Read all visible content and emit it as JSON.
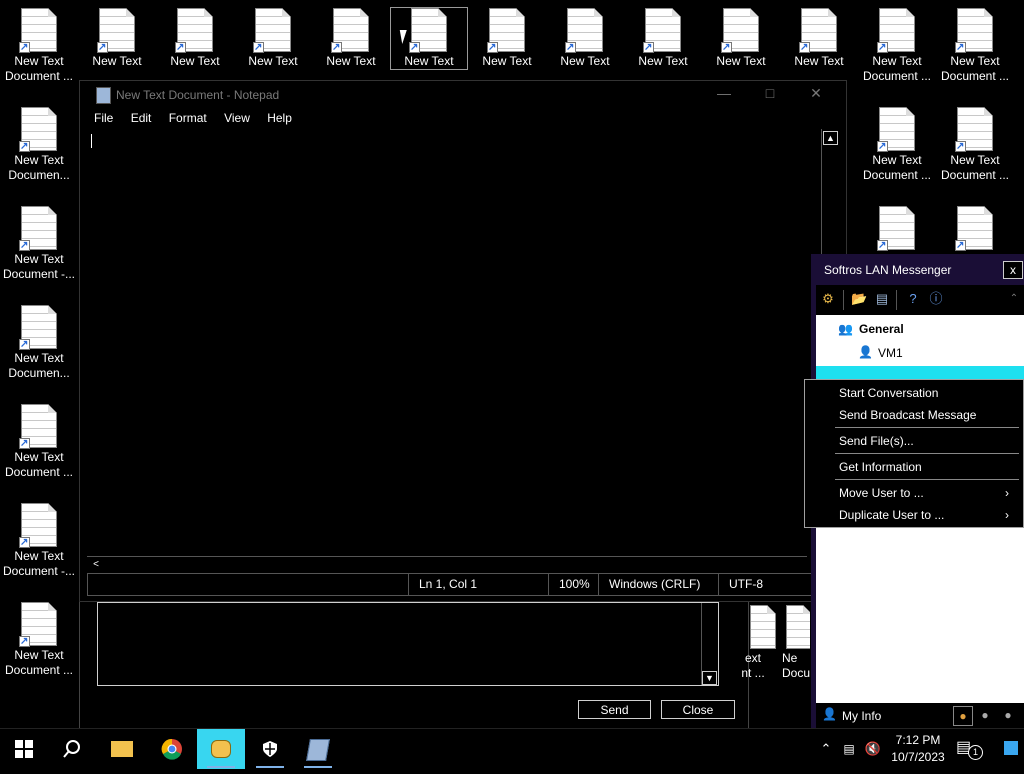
{
  "desktop": {
    "icons_row1": [
      {
        "l1": "New Text",
        "l2": "Document ..."
      },
      {
        "l1": "New Text",
        "l2": ""
      },
      {
        "l1": "New Text",
        "l2": ""
      },
      {
        "l1": "New Text",
        "l2": ""
      },
      {
        "l1": "New Text",
        "l2": ""
      },
      {
        "l1": "New Text",
        "l2": ""
      },
      {
        "l1": "New Text",
        "l2": ""
      },
      {
        "l1": "New Text",
        "l2": ""
      },
      {
        "l1": "New Text",
        "l2": ""
      },
      {
        "l1": "New Text",
        "l2": ""
      },
      {
        "l1": "New Text",
        "l2": ""
      },
      {
        "l1": "New Text",
        "l2": "Document ..."
      },
      {
        "l1": "New Text",
        "l2": "Document ..."
      }
    ],
    "icons_col1": [
      {
        "l1": "New Text",
        "l2": "Documen..."
      },
      {
        "l1": "New Text",
        "l2": "Document -..."
      },
      {
        "l1": "New Text",
        "l2": "Documen..."
      },
      {
        "l1": "New Text",
        "l2": "Document ..."
      },
      {
        "l1": "New Text",
        "l2": "Document -..."
      },
      {
        "l1": "New Text",
        "l2": "Document ..."
      }
    ],
    "icons_right": [
      {
        "l1": "New Text",
        "l2": "Document ..."
      },
      {
        "l1": "New Text",
        "l2": "Document ..."
      }
    ],
    "icons_partial": [
      {
        "l1": "ext",
        "l2": "nt ..."
      },
      {
        "l1": "Ne",
        "l2": "Docu"
      }
    ]
  },
  "notepad": {
    "title": "New Text Document - Notepad",
    "menu": [
      "File",
      "Edit",
      "Format",
      "View",
      "Help"
    ],
    "status": {
      "position": "Ln 1, Col 1",
      "zoom": "100%",
      "line_ending": "Windows (CRLF)",
      "encoding": "UTF-8"
    }
  },
  "chat": {
    "send_label": "Send",
    "close_label": "Close"
  },
  "messenger": {
    "title": "Softros LAN Messenger",
    "close": "x",
    "group": "General",
    "users": [
      "VM1"
    ],
    "my_info": "My Info"
  },
  "context_menu": {
    "items": [
      "Start Conversation",
      "Send Broadcast Message",
      "Send File(s)...",
      "Get Information",
      "Move User to ...",
      "Duplicate User to ..."
    ]
  },
  "taskbar": {
    "time": "7:12 PM",
    "date": "10/7/2023",
    "notifications": "1"
  }
}
